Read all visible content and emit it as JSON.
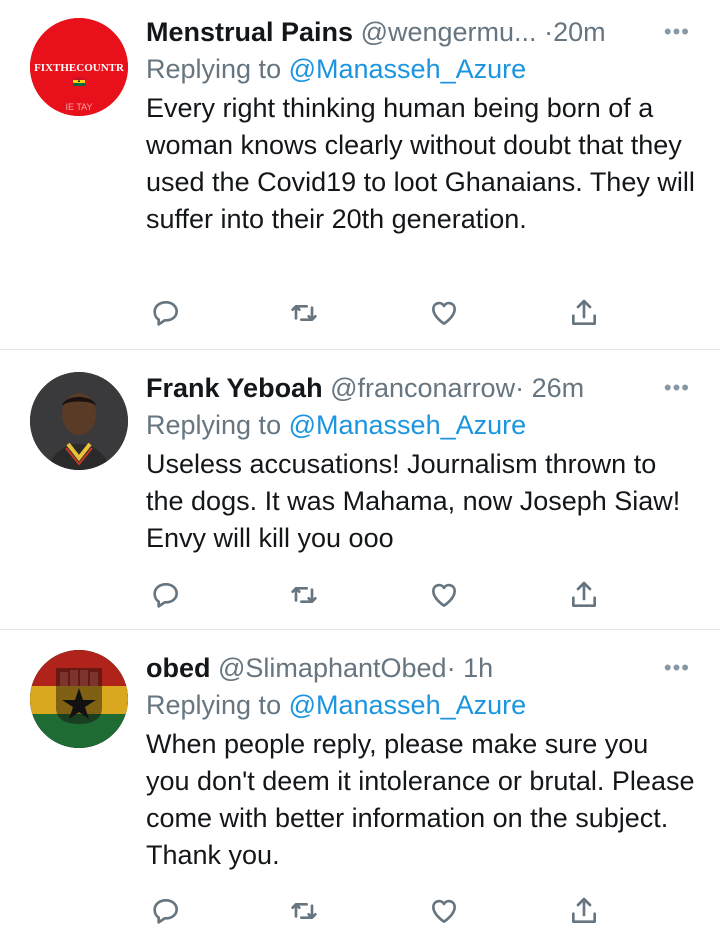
{
  "tweets": [
    {
      "name": "Menstrual Pains",
      "handle": "@wengermu...",
      "dot": "·",
      "time": "20m",
      "reply_prefix": "Replying to",
      "reply_to": "@Manasseh_Azure",
      "text": "Every right thinking human being born of a woman knows clearly without doubt that they used the Covid19 to loot Ghanaians. They will suffer into their 20th generation.",
      "avatar_text": "FixTheCountry",
      "avatar_color": "#e8101a"
    },
    {
      "name": "Frank Yeboah",
      "handle": "@franconarrow",
      "dot": "·",
      "time": "26m",
      "reply_prefix": "Replying to",
      "reply_to": "@Manasseh_Azure",
      "text": "Useless accusations! Journalism thrown to the dogs. It was Mahama, now Joseph Siaw! Envy will kill you ooo",
      "avatar_color": "#2b2a2c"
    },
    {
      "name": "obed",
      "handle": "@SlimaphantObed",
      "dot": "·",
      "time": "1h",
      "reply_prefix": "Replying to",
      "reply_to": "@Manasseh_Azure",
      "text": "When people reply, please  make sure you you don't deem it intolerance or brutal. Please come with better information on the subject. Thank you.",
      "avatar_color": "#1a1a1a"
    }
  ],
  "icons": {
    "more": "more-icon",
    "reply": "reply-icon",
    "retweet": "retweet-icon",
    "like": "like-icon",
    "share": "share-icon"
  },
  "colors": {
    "link": "#1b95e0",
    "muted": "#66757f",
    "divider": "#dfe3e6"
  }
}
